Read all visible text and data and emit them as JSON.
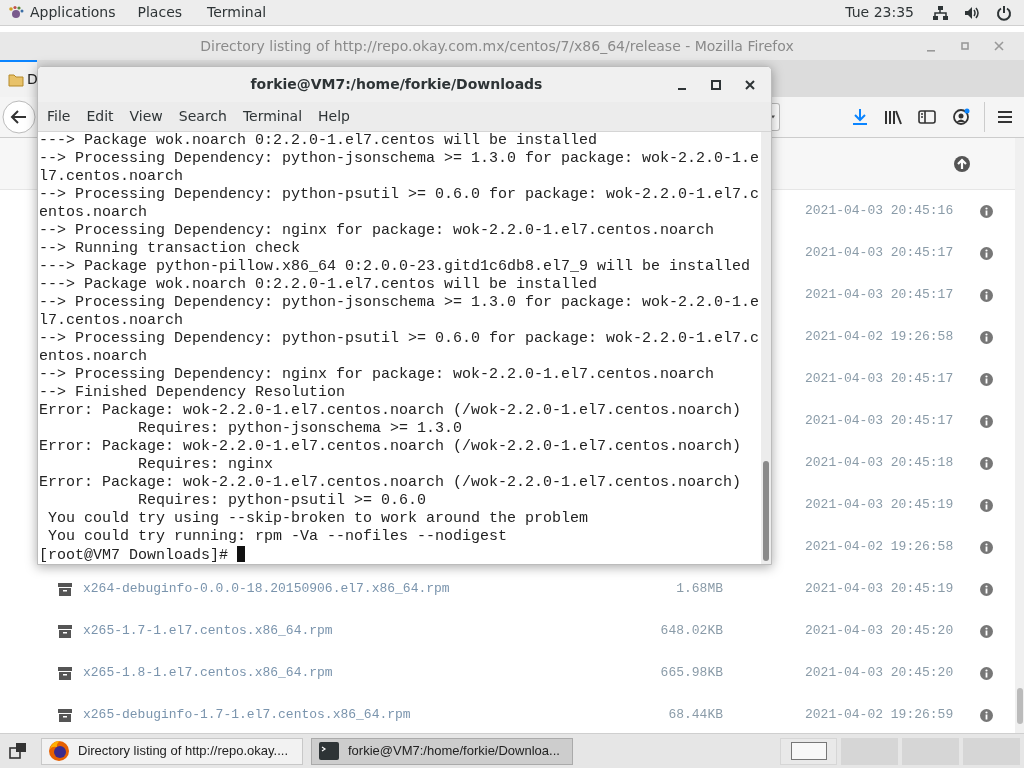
{
  "top_bar": {
    "menus": [
      "Applications",
      "Places",
      "Terminal"
    ],
    "clock": "Tue 23:35"
  },
  "browser": {
    "title": "Directory listing of http://repo.okay.com.mx/centos/7/x86_64/release - Mozilla Firefox",
    "tab_label": "D",
    "rows": [
      {
        "date": "2021-04-03 20:45:16"
      },
      {
        "date": "2021-04-03 20:45:17"
      },
      {
        "date": "2021-04-03 20:45:17"
      },
      {
        "date": "2021-04-02 19:26:58"
      },
      {
        "date": "2021-04-03 20:45:17"
      },
      {
        "date": "2021-04-03 20:45:17"
      },
      {
        "date": "2021-04-03 20:45:18"
      },
      {
        "date": "2021-04-03 20:45:19"
      },
      {
        "date": "2021-04-02 19:26:58"
      },
      {
        "name": "x264-debuginfo-0.0.0-18.20150906.el7.x86_64.rpm",
        "size": "1.68MB",
        "date": "2021-04-03 20:45:19"
      },
      {
        "name": "x265-1.7-1.el7.centos.x86_64.rpm",
        "size": "648.02KB",
        "date": "2021-04-03 20:45:20"
      },
      {
        "name": "x265-1.8-1.el7.centos.x86_64.rpm",
        "size": "665.98KB",
        "date": "2021-04-03 20:45:20"
      },
      {
        "name": "x265-debuginfo-1.7-1.el7.centos.x86_64.rpm",
        "size": "68.44KB",
        "date": "2021-04-02 19:26:59"
      }
    ]
  },
  "terminal": {
    "title": "forkie@VM7:/home/forkie/Downloads",
    "menu": [
      "File",
      "Edit",
      "View",
      "Search",
      "Terminal",
      "Help"
    ],
    "lines": [
      "---> Package wok.noarch 0:2.2.0-1.el7.centos will be installed",
      "--> Processing Dependency: python-jsonschema >= 1.3.0 for package: wok-2.2.0-1.e",
      "l7.centos.noarch",
      "--> Processing Dependency: python-psutil >= 0.6.0 for package: wok-2.2.0-1.el7.c",
      "entos.noarch",
      "--> Processing Dependency: nginx for package: wok-2.2.0-1.el7.centos.noarch",
      "--> Running transaction check",
      "---> Package python-pillow.x86_64 0:2.0.0-23.gitd1c6db8.el7_9 will be installed",
      "---> Package wok.noarch 0:2.2.0-1.el7.centos will be installed",
      "--> Processing Dependency: python-jsonschema >= 1.3.0 for package: wok-2.2.0-1.e",
      "l7.centos.noarch",
      "--> Processing Dependency: python-psutil >= 0.6.0 for package: wok-2.2.0-1.el7.c",
      "entos.noarch",
      "--> Processing Dependency: nginx for package: wok-2.2.0-1.el7.centos.noarch",
      "--> Finished Dependency Resolution",
      "Error: Package: wok-2.2.0-1.el7.centos.noarch (/wok-2.2.0-1.el7.centos.noarch)",
      "           Requires: python-jsonschema >= 1.3.0",
      "Error: Package: wok-2.2.0-1.el7.centos.noarch (/wok-2.2.0-1.el7.centos.noarch)",
      "           Requires: nginx",
      "Error: Package: wok-2.2.0-1.el7.centos.noarch (/wok-2.2.0-1.el7.centos.noarch)",
      "           Requires: python-psutil >= 0.6.0",
      " You could try using --skip-broken to work around the problem",
      " You could try running: rpm -Va --nofiles --nodigest"
    ],
    "prompt": "[root@VM7 Downloads]# "
  },
  "taskbar": {
    "tasks": [
      {
        "kind": "browser",
        "label": "Directory listing of http://repo.okay....",
        "selected": false
      },
      {
        "kind": "terminal",
        "label": "forkie@VM7:/home/forkie/Downloa...",
        "selected": true
      }
    ],
    "workspaces": [
      {
        "selected": true
      },
      {
        "selected": false
      },
      {
        "selected": false
      },
      {
        "selected": false
      }
    ]
  }
}
